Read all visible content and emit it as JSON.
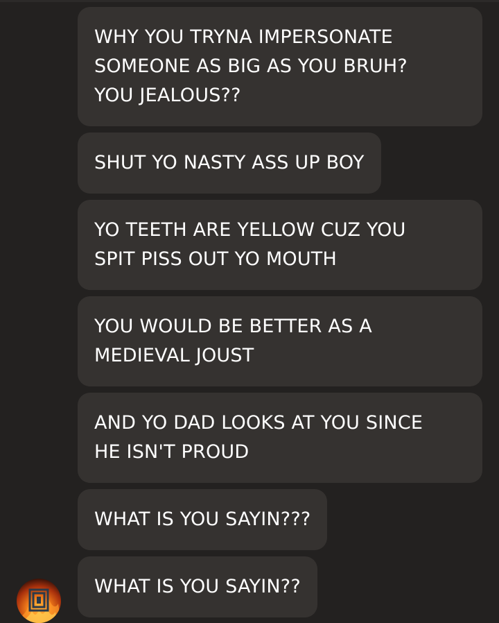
{
  "messages": [
    {
      "text": "WHY YOU TRYNA IMPERSONATE\nSOMEONE AS BIG AS YOU BRUH?\nYOU JEALOUS??"
    },
    {
      "text": "SHUT YO NASTY ASS UP BOY"
    },
    {
      "text": "YO TEETH ARE YELLOW CUZ YOU\nSPIT PISS OUT YO MOUTH"
    },
    {
      "text": "YOU WOULD BE BETTER AS A\nMEDIEVAL JOUST"
    },
    {
      "text": "AND YO DAD LOOKS AT YOU SINCE\nHE ISN'T PROUD"
    },
    {
      "text": "WHAT IS YOU SAYIN???"
    },
    {
      "text": "WHAT IS YOU SAYIN??"
    }
  ],
  "avatar": {
    "icon": "flaming-logo-avatar-icon"
  },
  "colors": {
    "background": "#232120",
    "bubble": "#353230",
    "text": "#ffffff"
  }
}
